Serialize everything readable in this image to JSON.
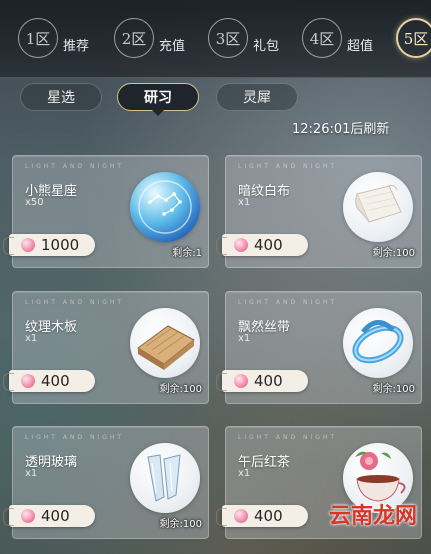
{
  "nav": {
    "zones": [
      {
        "num": "1区",
        "label": "推荐"
      },
      {
        "num": "2区",
        "label": "充值"
      },
      {
        "num": "3区",
        "label": "礼包"
      },
      {
        "num": "4区",
        "label": "超值"
      },
      {
        "num": "5区",
        "label": ""
      }
    ],
    "active_zone": 4
  },
  "tabs": {
    "items": [
      {
        "label": "星选"
      },
      {
        "label": "研习"
      },
      {
        "label": "灵犀"
      }
    ],
    "active": 1
  },
  "refresh_text": "12:26:01后刷新",
  "card_watermark": "LIGHT AND NIGHT",
  "items": [
    {
      "name": "小熊星座",
      "qty": "x50",
      "price": "1000",
      "remain": "剩余:1",
      "icon": "ursa-orb-icon"
    },
    {
      "name": "暗纹白布",
      "qty": "x1",
      "price": "400",
      "remain": "剩余:100",
      "icon": "white-cloth-icon"
    },
    {
      "name": "纹理木板",
      "qty": "x1",
      "price": "400",
      "remain": "剩余:100",
      "icon": "wood-plank-icon"
    },
    {
      "name": "飘然丝带",
      "qty": "x1",
      "price": "400",
      "remain": "剩余:100",
      "icon": "silk-ribbon-icon"
    },
    {
      "name": "透明玻璃",
      "qty": "x1",
      "price": "400",
      "remain": "剩余:100",
      "icon": "glass-shard-icon"
    },
    {
      "name": "午后红茶",
      "qty": "x1",
      "price": "400",
      "remain": "",
      "icon": "black-tea-icon"
    }
  ],
  "site_watermark": "云南龙网"
}
